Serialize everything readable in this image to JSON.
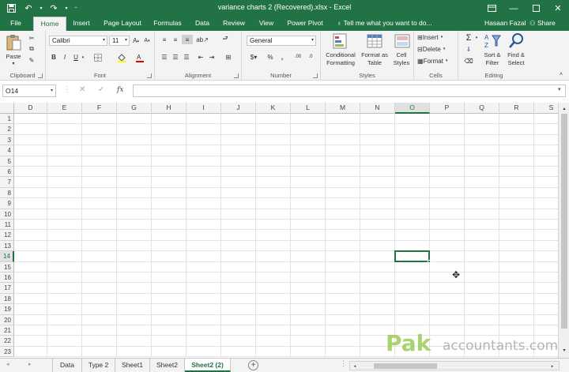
{
  "window": {
    "title": "variance charts 2 (Recovered).xlsx - Excel",
    "user": "Hasaan Fazal",
    "share_label": "Share"
  },
  "ribbon_tabs": [
    "File",
    "Home",
    "Insert",
    "Page Layout",
    "Formulas",
    "Data",
    "Review",
    "View",
    "Power Pivot"
  ],
  "active_tab": "Home",
  "tell_me": "Tell me what you want to do...",
  "ribbon": {
    "clipboard": {
      "label": "Clipboard",
      "paste": "Paste"
    },
    "font": {
      "label": "Font",
      "font_name": "Calibri",
      "font_size": "11"
    },
    "alignment": {
      "label": "Alignment"
    },
    "number": {
      "label": "Number",
      "format": "General"
    },
    "styles": {
      "label": "Styles",
      "cond_fmt_1": "Conditional",
      "cond_fmt_2": "Formatting",
      "fmt_table_1": "Format as",
      "fmt_table_2": "Table",
      "cell_styles_1": "Cell",
      "cell_styles_2": "Styles"
    },
    "cells": {
      "label": "Cells",
      "insert": "Insert",
      "delete": "Delete",
      "format": "Format"
    },
    "editing": {
      "label": "Editing",
      "sort_1": "Sort &",
      "sort_2": "Filter",
      "find_1": "Find &",
      "find_2": "Select"
    }
  },
  "formula_bar": {
    "name_box": "O14",
    "fx": "fx",
    "content": ""
  },
  "columns": [
    "D",
    "E",
    "F",
    "G",
    "H",
    "I",
    "J",
    "K",
    "L",
    "M",
    "N",
    "O",
    "P",
    "Q",
    "R",
    "S"
  ],
  "rows": [
    "1",
    "2",
    "3",
    "4",
    "5",
    "6",
    "7",
    "8",
    "9",
    "10",
    "11",
    "12",
    "13",
    "14",
    "15",
    "16",
    "17",
    "18",
    "19",
    "20",
    "21",
    "22",
    "23"
  ],
  "active_cell": {
    "column": "O",
    "row": "14"
  },
  "sheet_tabs": [
    "Data",
    "Type 2",
    "Sheet1",
    "Sheet2",
    "Sheet2 (2)"
  ],
  "active_sheet": "Sheet2 (2)",
  "watermark": {
    "brand": "Pak",
    "site": "accountants.com"
  },
  "colors": {
    "accent": "#217346",
    "watermark_green": "#8fc43f"
  }
}
